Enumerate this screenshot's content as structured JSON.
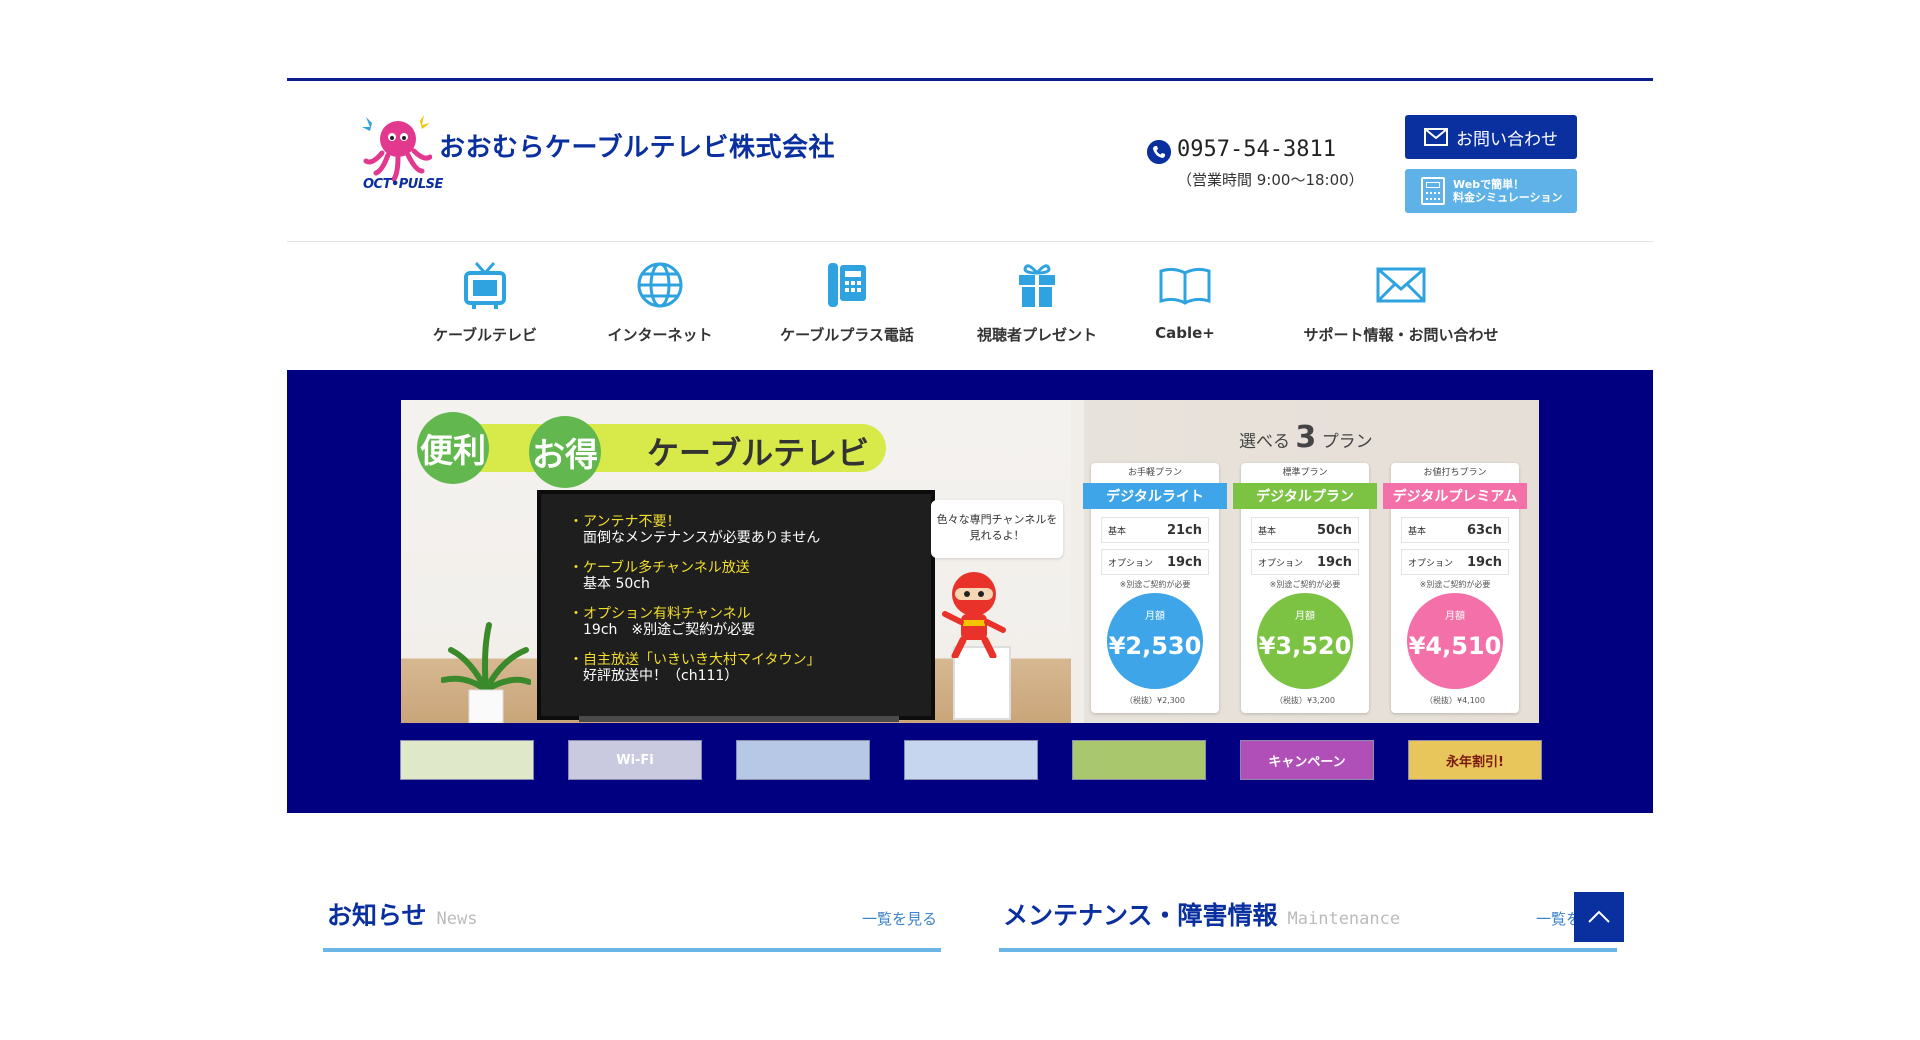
{
  "header": {
    "logo_text": "OCT•PULSE",
    "company_name": "おおむらケーブルテレビ株式会社",
    "phone": "0957-54-3811",
    "hours": "（営業時間 9:00〜18:00）",
    "contact_button": "お問い合わせ",
    "sim_button_line1": "Webで簡単！",
    "sim_button_line2": "料金シミュレーション"
  },
  "nav": {
    "items": [
      {
        "label": "ケーブルテレビ",
        "icon": "tv-icon"
      },
      {
        "label": "インターネット",
        "icon": "globe-icon"
      },
      {
        "label": "ケーブルプラス電話",
        "icon": "phone-icon"
      },
      {
        "label": "視聴者プレゼント",
        "icon": "gift-icon"
      },
      {
        "label": "Cable+",
        "icon": "book-icon"
      },
      {
        "label": "サポート情報・お問い合わせ",
        "icon": "mail-icon"
      }
    ]
  },
  "hero": {
    "tag1": "便利",
    "tag2": "お得",
    "tag_title": "ケーブルテレビ",
    "tv_lines": [
      {
        "text": "・アンテナ不要！",
        "highlight": true
      },
      {
        "text": "　面倒なメンテナンスが必要ありません",
        "highlight": false
      },
      {
        "text": "・ケーブル多チャンネル放送",
        "highlight": true
      },
      {
        "text": "　基本 50ch",
        "highlight": false
      },
      {
        "text": "・オプション有料チャンネル",
        "highlight": true
      },
      {
        "text": "　19ch　※別途ご契約が必要",
        "highlight": false
      },
      {
        "text": "・自主放送「いきいき大村マイタウン」",
        "highlight": true
      },
      {
        "text": "　好評放送中！（ch111）",
        "highlight": false
      }
    ],
    "bubble_line1": "色々な専門チャンネルを",
    "bubble_line2": "見れるよ！",
    "plans_title_pre": "選べる",
    "plans_title_num": "3",
    "plans_title_post": "プラン",
    "plans": [
      {
        "sub": "お手軽プラン",
        "name": "デジタルライト",
        "color": "#3da5e8",
        "basic_label": "基本",
        "basic": "21ch",
        "opt_label": "オプション",
        "opt": "19ch",
        "note": "※別途ご契約が必要",
        "monthly": "月額",
        "price": "¥2,530",
        "tax": "（税抜）¥2,300"
      },
      {
        "sub": "標準プラン",
        "name": "デジタルプラン",
        "color": "#7cc243",
        "basic_label": "基本",
        "basic": "50ch",
        "opt_label": "オプション",
        "opt": "19ch",
        "note": "※別途ご契約が必要",
        "monthly": "月額",
        "price": "¥3,520",
        "tax": "（税抜）¥3,200"
      },
      {
        "sub": "お値打ちプラン",
        "name": "デジタルプレミアム",
        "color": "#f470a8",
        "basic_label": "基本",
        "basic": "63ch",
        "opt_label": "オプション",
        "opt": "19ch",
        "note": "※別途ご契約が必要",
        "monthly": "月額",
        "price": "¥4,510",
        "tax": "（税抜）¥4,100"
      }
    ]
  },
  "thumbs": [
    {
      "label": "",
      "bg": "#dfe9c9"
    },
    {
      "label": "Wi-Fi",
      "bg": "#c9c9df"
    },
    {
      "label": "",
      "bg": "#b7c8e6"
    },
    {
      "label": "",
      "bg": "#c6d6ee"
    },
    {
      "label": "",
      "bg": "#a9c86d"
    },
    {
      "label": "キャンペーン",
      "bg": "#b04fb8"
    },
    {
      "label": "永年割引!",
      "bg": "#e8c65c"
    }
  ],
  "info": {
    "news_title": "お知らせ",
    "news_en": "News",
    "news_more": "一覧を見る",
    "maint_title": "メンテナンス・障害情報",
    "maint_en": "Maintenance",
    "maint_more": "一覧を"
  },
  "colors": {
    "brand": "#0a2f9f",
    "banner_bg": "#000080",
    "accent_light": "#6bb4e8"
  }
}
